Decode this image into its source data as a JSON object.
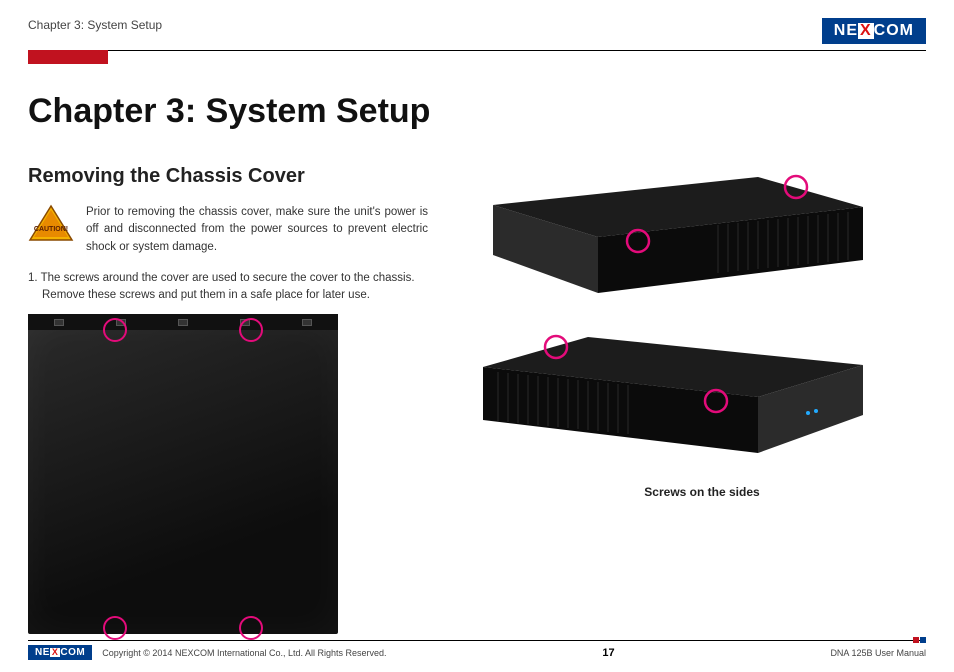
{
  "header": {
    "breadcrumb": "Chapter 3: System Setup",
    "logo_parts": {
      "pre": "NE",
      "x": "X",
      "post": "COM"
    }
  },
  "chapter_title": "Chapter 3: System Setup",
  "section_title": "Removing the Chassis Cover",
  "caution": {
    "icon_label": "CAUTION!",
    "text": "Prior to removing the chassis cover, make sure the unit's power is off and disconnected from the power sources to prevent electric shock or system damage."
  },
  "step1": "1.  The screws around the cover are used to secure the cover to the chassis. Remove these screws and put them in a safe place for later use.",
  "caption_sides": "Screws on the sides",
  "footer": {
    "copyright": "Copyright © 2014 NEXCOM International Co., Ltd. All Rights Reserved.",
    "page": "17",
    "manual": "DNA 125B User Manual"
  },
  "colors": {
    "brand_blue": "#003e8c",
    "brand_red": "#c1121f",
    "mark_pink": "#e30b7a"
  }
}
